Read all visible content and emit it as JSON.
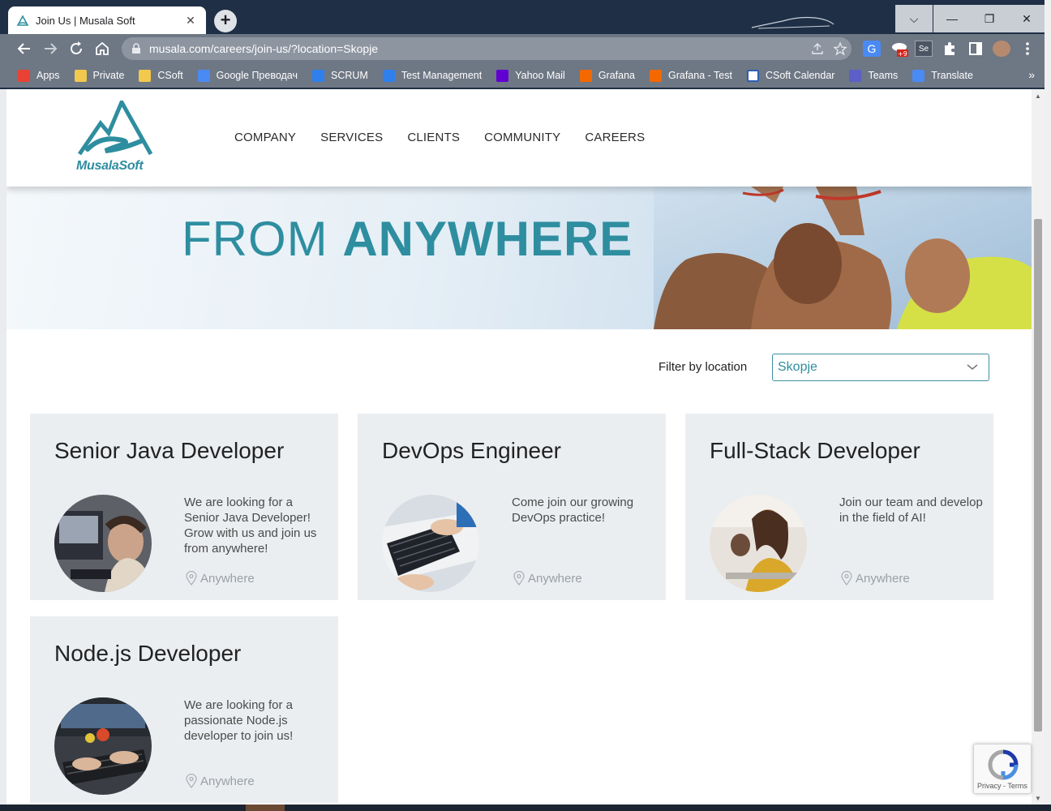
{
  "browser": {
    "tab_title": "Join Us | Musala Soft",
    "tab_close": "✕",
    "new_tab": "+",
    "url": "musala.com/careers/join-us/?location=Skopje",
    "window_controls": [
      "⌵",
      "—",
      "❐",
      "✕"
    ],
    "nav_icons": [
      "arrow-left-icon",
      "arrow-right-icon",
      "reload-icon",
      "home-icon"
    ],
    "bookmarks": [
      {
        "label": "Apps",
        "icon": "apps-grid-icon",
        "color": "#e94235"
      },
      {
        "label": "Private",
        "icon": "folder-icon",
        "color": "#f2c94c"
      },
      {
        "label": "CSoft",
        "icon": "folder-icon",
        "color": "#f2c94c"
      },
      {
        "label": "Google Преводач",
        "icon": "translate-icon",
        "color": "#4a8af4"
      },
      {
        "label": "SCRUM",
        "icon": "azure-devops-icon",
        "color": "#2f80ed"
      },
      {
        "label": "Test Management",
        "icon": "azure-devops-icon",
        "color": "#2f80ed"
      },
      {
        "label": "Yahoo Mail",
        "icon": "mail-icon",
        "color": "#6001d2"
      },
      {
        "label": "Grafana",
        "icon": "grafana-icon",
        "color": "#f46800"
      },
      {
        "label": "Grafana - Test",
        "icon": "grafana-icon",
        "color": "#f46800"
      },
      {
        "label": "CSoft Calendar",
        "icon": "calendar-icon",
        "color": "#ffffff"
      },
      {
        "label": "Teams",
        "icon": "teams-icon",
        "color": "#5b5fc7"
      },
      {
        "label": "Translate",
        "icon": "translate-icon",
        "color": "#4a8af4"
      }
    ],
    "bookmarks_more": "»",
    "extension_badge": "+9"
  },
  "header": {
    "logo_text": "MusalaSoft",
    "nav": [
      "COMPANY",
      "SERVICES",
      "CLIENTS",
      "COMMUNITY",
      "CAREERS"
    ]
  },
  "hero": {
    "line_regular": "FROM ",
    "line_bold": "ANYWHERE"
  },
  "filter": {
    "label": "Filter by location",
    "selected": "Skopje"
  },
  "jobs": [
    {
      "title": "Senior Java Developer",
      "description": "We are looking for a Senior Java Developer! Grow with us and join us from anywhere!",
      "location": "Anywhere"
    },
    {
      "title": "DevOps Engineer",
      "description": "Come join our growing DevOps practice!",
      "location": "Anywhere"
    },
    {
      "title": "Full-Stack Developer",
      "description": "Join our team and develop in the field of AI!",
      "location": "Anywhere"
    },
    {
      "title": "Node.js Developer",
      "description": "We are looking for a passionate Node.js developer to join us!",
      "location": "Anywhere"
    }
  ],
  "recaptcha": {
    "links": "Privacy - Terms"
  },
  "colors": {
    "brand": "#2e8ea0",
    "card_bg": "#ebeef1",
    "chrome_dark": "#1f2f45",
    "chrome_toolbar": "#6e7784"
  }
}
